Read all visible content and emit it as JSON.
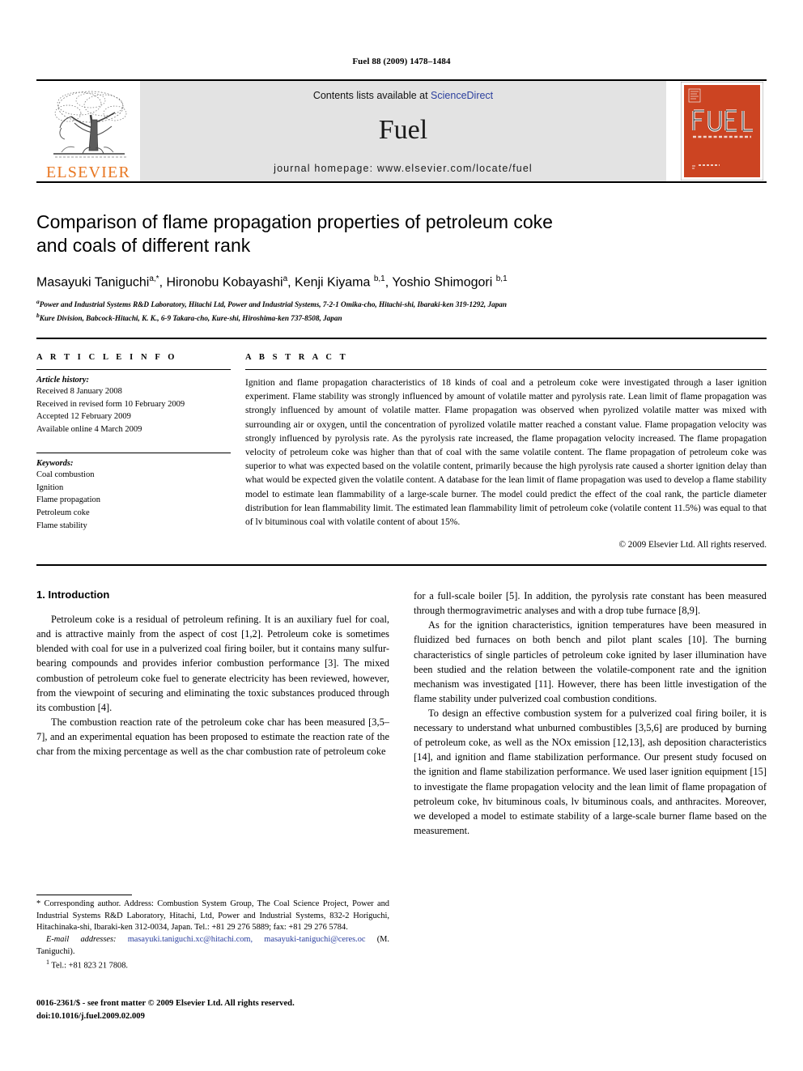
{
  "running_head": "Fuel 88 (2009) 1478–1484",
  "journal_band": {
    "contents_prefix": "Contents lists available at ",
    "sciencedirect_link": "ScienceDirect",
    "journal_name": "Fuel",
    "homepage": "journal homepage: www.elsevier.com/locate/fuel",
    "publisher_name": "ELSEVIER",
    "cover_title": "FUEL",
    "cover_subtitle": "the science and technology of fuel and energy",
    "accent_orange": "#E87722",
    "cover_red": "#CC4422",
    "link_blue": "#2b3f9e",
    "band_gray": "#e3e3e3"
  },
  "title": {
    "line1": "Comparison of flame propagation properties of petroleum coke",
    "line2": "and coals of different rank"
  },
  "authors": {
    "list": [
      {
        "name": "Masayuki Taniguchi",
        "sup": "a,*"
      },
      {
        "name": "Hironobu Kobayashi",
        "sup": "a"
      },
      {
        "name": "Kenji Kiyama",
        "sup": "b,1"
      },
      {
        "name": "Yoshio Shimogori",
        "sup": "b,1"
      }
    ],
    "affiliations": [
      {
        "marker": "a",
        "text": "Power and Industrial Systems R&D Laboratory, Hitachi Ltd, Power and Industrial Systems, 7-2-1 Omika-cho, Hitachi-shi, Ibaraki-ken 319-1292, Japan"
      },
      {
        "marker": "b",
        "text": "Kure Division, Babcock-Hitachi, K. K., 6-9 Takara-cho, Kure-shi, Hiroshima-ken 737-8508, Japan"
      }
    ]
  },
  "article_info": {
    "heading": "A R T I C L E    I N F O",
    "history_label": "Article history:",
    "history": [
      "Received 8 January 2008",
      "Received in revised form 10 February 2009",
      "Accepted 12 February 2009",
      "Available online 4 March 2009"
    ],
    "keywords_label": "Keywords:",
    "keywords": [
      "Coal combustion",
      "Ignition",
      "Flame propagation",
      "Petroleum coke",
      "Flame stability"
    ]
  },
  "abstract": {
    "heading": "A B S T R A C T",
    "text": "Ignition and flame propagation characteristics of 18 kinds of coal and a petroleum coke were investigated through a laser ignition experiment. Flame stability was strongly influenced by amount of volatile matter and pyrolysis rate. Lean limit of flame propagation was strongly influenced by amount of volatile matter. Flame propagation was observed when pyrolized volatile matter was mixed with surrounding air or oxygen, until the concentration of pyrolized volatile matter reached a constant value. Flame propagation velocity was strongly influenced by pyrolysis rate. As the pyrolysis rate increased, the flame propagation velocity increased. The flame propagation velocity of petroleum coke was higher than that of coal with the same volatile content. The flame propagation of petroleum coke was superior to what was expected based on the volatile content, primarily because the high pyrolysis rate caused a shorter ignition delay than what would be expected given the volatile content. A database for the lean limit of flame propagation was used to develop a flame stability model to estimate lean flammability of a large-scale burner. The model could predict the effect of the coal rank, the particle diameter distribution for lean flammability limit. The estimated lean flammability limit of petroleum coke (volatile content 11.5%) was equal to that of lv bituminous coal with volatile content of about 15%.",
    "copyright": "© 2009 Elsevier Ltd. All rights reserved."
  },
  "body": {
    "section_title": "1. Introduction",
    "left_paragraphs": [
      "Petroleum coke is a residual of petroleum refining. It is an auxiliary fuel for coal, and is attractive mainly from the aspect of cost [1,2]. Petroleum coke is sometimes blended with coal for use in a pulverized coal firing boiler, but it contains many sulfur-bearing compounds and provides inferior combustion performance [3]. The mixed combustion of petroleum coke fuel to generate electricity has been reviewed, however, from the viewpoint of securing and eliminating the toxic substances produced through its combustion [4].",
      "The combustion reaction rate of the petroleum coke char has been measured [3,5–7], and an experimental equation has been proposed to estimate the reaction rate of the char from the mixing percentage as well as the char combustion rate of petroleum coke"
    ],
    "right_paragraphs": [
      "for a full-scale boiler [5]. In addition, the pyrolysis rate constant has been measured through thermogravimetric analyses and with a drop tube furnace [8,9].",
      "As for the ignition characteristics, ignition temperatures have been measured in fluidized bed furnaces on both bench and pilot plant scales [10]. The burning characteristics of single particles of petroleum coke ignited by laser illumination have been studied and the relation between the volatile-component rate and the ignition mechanism was investigated [11]. However, there has been little investigation of the flame stability under pulverized coal combustion conditions.",
      "To design an effective combustion system for a pulverized coal firing boiler, it is necessary to understand what unburned combustibles [3,5,6] are produced by burning of petroleum coke, as well as the NOx emission [12,13], ash deposition characteristics [14], and ignition and flame stabilization performance. Our present study focused on the ignition and flame stabilization performance. We used laser ignition equipment [15] to investigate the flame propagation velocity and the lean limit of flame propagation of petroleum coke, hv bituminous coals, lv bituminous coals, and anthracites. Moreover, we developed a model to estimate stability of a large-scale burner flame based on the measurement."
    ]
  },
  "footnote": {
    "corresponding": "* Corresponding author. Address: Combustion System Group, The Coal Science Project, Power and Industrial Systems R&D Laboratory, Hitachi, Ltd, Power and Industrial Systems, 832-2 Horiguchi, Hitachinaka-shi, Ibaraki-ken 312-0034, Japan. Tel.: +81 29 276 5889; fax: +81 29 276 5784.",
    "email_label": "E-mail addresses:",
    "emails": "masayuki.taniguchi.xc@hitachi.com, masayuki-taniguchi@ceres.oc",
    "email_suffix": " (M. Taniguchi).",
    "note1_marker": "1",
    "note1": "Tel.: +81 823 21 7808."
  },
  "issn": {
    "line1": "0016-2361/$ - see front matter © 2009 Elsevier Ltd. All rights reserved.",
    "line2": "doi:10.1016/j.fuel.2009.02.009"
  }
}
